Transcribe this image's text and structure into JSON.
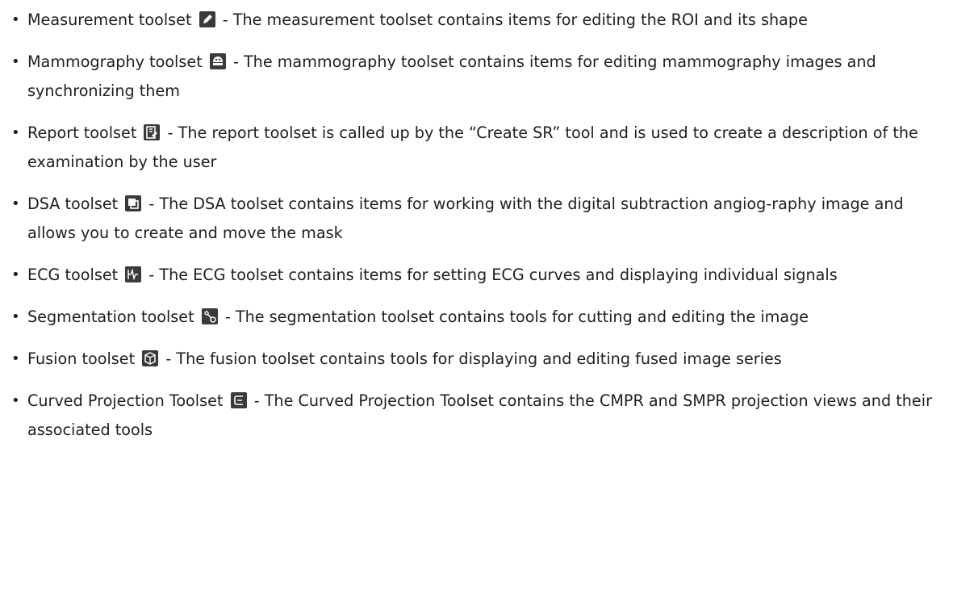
{
  "items": [
    {
      "name": "Measurement toolset",
      "icon": "pencil-icon",
      "description": " - The measurement toolset contains items for editing the ROI and its shape"
    },
    {
      "name": "Mammography toolset",
      "icon": "mammography-icon",
      "description": " - The mammography toolset contains items for editing mammography images and synchronizing them"
    },
    {
      "name": "Report toolset",
      "icon": "report-edit-icon",
      "description": " - The report toolset is called up by the “Create SR” tool and is used to create a description of the examination by the user"
    },
    {
      "name": "DSA toolset",
      "icon": "dsa-copy-icon",
      "description": " - The DSA toolset contains items for working with the digital subtraction angiog-raphy image and allows you to create and move the mask"
    },
    {
      "name": "ECG toolset",
      "icon": "ecg-icon",
      "description": " - The ECG toolset contains items for setting ECG curves and displaying individual signals"
    },
    {
      "name": "Segmentation toolset",
      "icon": "segmentation-icon",
      "description": " - The segmentation toolset contains tools for cutting and editing the image"
    },
    {
      "name": "Fusion toolset",
      "icon": "fusion-cube-icon",
      "description": " - The fusion toolset contains tools for displaying and editing fused image series"
    },
    {
      "name": "Curved Projection Toolset",
      "icon": "cmpr-icon",
      "description": " - The Curved Projection Toolset contains the CMPR and SMPR projection views and their associated tools"
    }
  ]
}
